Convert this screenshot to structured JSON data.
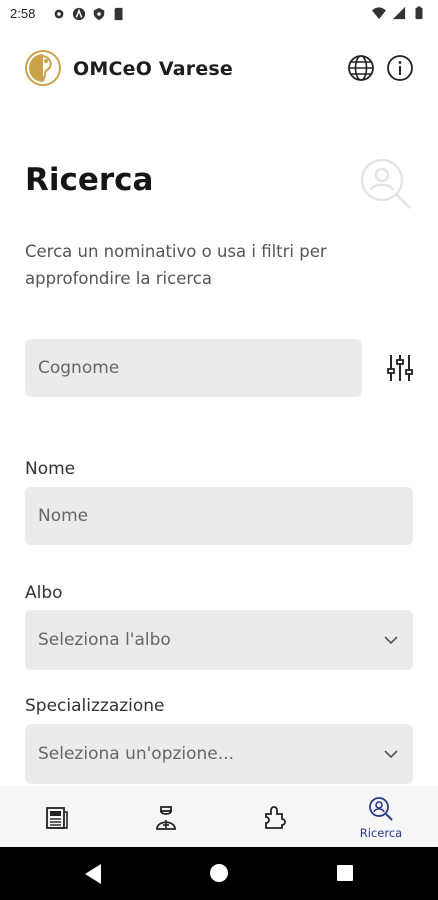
{
  "status_bar": {
    "time": "2:58"
  },
  "header": {
    "app_title": "OMCeO Varese"
  },
  "page": {
    "title": "Ricerca",
    "intro": "Cerca un nominativo o usa i filtri per approfondire la ricerca"
  },
  "form": {
    "cognome_placeholder": "Cognome",
    "nome_label": "Nome",
    "nome_placeholder": "Nome",
    "albo_label": "Albo",
    "albo_value": "Seleziona l'albo",
    "spec_label": "Specializzazione",
    "spec_value": "Seleziona un'opzione..."
  },
  "bottom_nav": {
    "items": [
      {
        "icon": "news-icon",
        "label": ""
      },
      {
        "icon": "doctor-icon",
        "label": ""
      },
      {
        "icon": "services-icon",
        "label": ""
      },
      {
        "icon": "search-person-icon",
        "label": "Ricerca",
        "active": true
      }
    ]
  },
  "colors": {
    "brand_gold": "#c9a24a",
    "active_nav": "#2a3a8a",
    "field_bg": "#ebebeb"
  }
}
